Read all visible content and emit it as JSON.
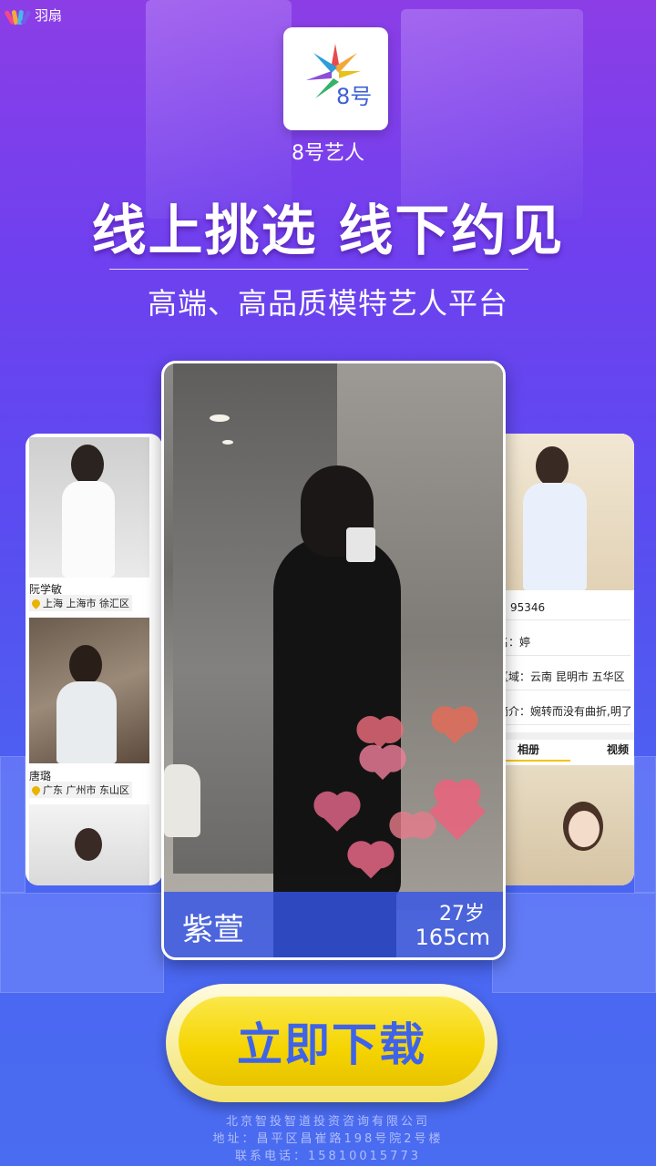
{
  "brand": {
    "label": "羽扇",
    "icon": "fan-logo-icon"
  },
  "app": {
    "icon": "app-8hao-logo-icon",
    "icon_text": "8号",
    "name": "8号艺人"
  },
  "hero": {
    "headline": "线上挑选  线下约见",
    "subline": "高端、高品质模特艺人平台"
  },
  "left_card": {
    "items": [
      {
        "name": "阮学敏",
        "location": "上海 上海市 徐汇区"
      },
      {
        "name": "唐璐",
        "location": "广东 广州市 东山区"
      }
    ]
  },
  "right_card": {
    "id_fragment": "95346",
    "name_row": "名：婷",
    "region_row": "区域：云南 昆明市 五华区",
    "intro_row": "简介：婉转而没有曲折,明了",
    "tabs": [
      "相册",
      "视频"
    ]
  },
  "main_card": {
    "name": "紫萱",
    "age": "27岁",
    "height": "165cm",
    "heart_color": "#f36b8c"
  },
  "download": {
    "label": "立即下载"
  },
  "footer": {
    "company": "北京智投智道投资咨询有限公司",
    "address": "地址：昌平区昌崔路198号院2号楼",
    "phone": "联系电话：15810015773"
  }
}
